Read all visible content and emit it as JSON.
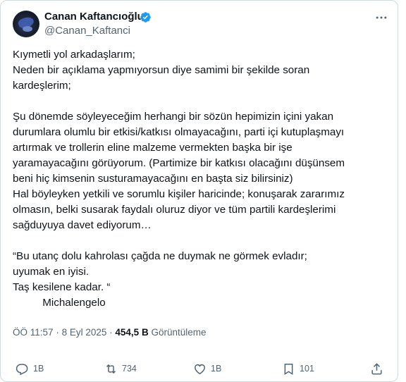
{
  "author": {
    "name": "Canan Kaftancıoğlu",
    "handle": "@Canan_Kaftanci"
  },
  "tweet": {
    "p1": "Kıymetli yol arkadaşlarım;\nNeden bir açıklama yapmıyorsun diye samimi bir şekilde soran\nkardeşlerim;",
    "p2": "Şu dönemde söyleyeceğim herhangi bir sözün hepimizin içini yakan\ndurumlara olumlu bir etkisi/katkısı olmayacağını, parti içi kutuplaşmayı\nartırmak ve trollerin eline malzeme vermekten başka bir işe\nyaramayacağını görüyorum. (Partimize bir katkısı olacağını düşünsem\nbeni hiç kimsenin susturamayacağını en başta siz bilirsiniz)\nHal böyleyken yetkili ve sorumlu kişiler haricinde; konuşarak zararımız\nolmasın, belki susarak faydalı oluruz diyor ve tüm partili kardeşlerimi\nsağduyuya davet ediyorum…",
    "p3": "“Bu utanç dolu kahrolası çağda ne duymak ne görmek evladır;\nuyumak en iyisi.\nTaş kesilene kadar. “\n          Michalengelo"
  },
  "meta": {
    "time": "ÖÖ 11:57",
    "separator": "·",
    "date": "8 Eyl 2025",
    "views_count": "454,5 B",
    "views_label": "Görüntüleme"
  },
  "actions": {
    "replies": "1B",
    "reposts": "734",
    "likes": "1B",
    "bookmarks": "101"
  },
  "icons": [
    "verified-badge-icon",
    "more-icon",
    "reply-icon",
    "repost-icon",
    "like-icon",
    "bookmark-icon",
    "share-icon"
  ],
  "colors": {
    "verified": "#1d9bf0",
    "muted": "#536471",
    "text": "#0f1419"
  }
}
